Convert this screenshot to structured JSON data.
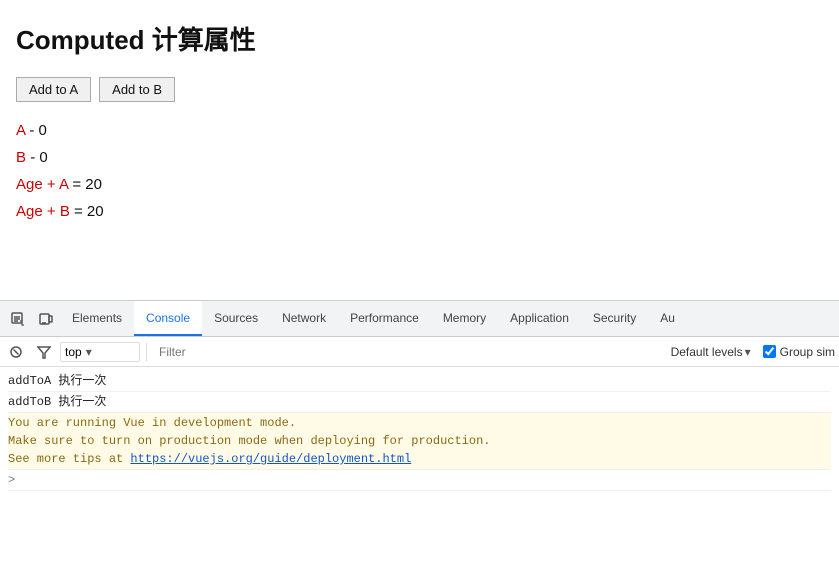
{
  "page": {
    "title": "Computed 计算属性"
  },
  "buttons": {
    "add_a": "Add to A",
    "add_b": "Add to B"
  },
  "data_lines": [
    {
      "label": "A",
      "value": "0"
    },
    {
      "label": "B",
      "value": "0"
    }
  ],
  "computed_lines": [
    {
      "text": "Age + A = 20"
    },
    {
      "text": "Age + B = 20"
    }
  ],
  "devtools": {
    "tabs": [
      "Elements",
      "Console",
      "Sources",
      "Network",
      "Performance",
      "Memory",
      "Application",
      "Security",
      "Au..."
    ],
    "active_tab": "Console",
    "context": "top",
    "filter_placeholder": "Filter",
    "default_levels": "Default levels",
    "group_sim": "Group sim"
  },
  "console": {
    "lines": [
      {
        "type": "info",
        "text": "addToA 执行一次"
      },
      {
        "type": "info",
        "text": "addToB 执行一次"
      },
      {
        "type": "warn",
        "text": "You are running Vue in development mode.\nMake sure to turn on production mode when deploying for production.\nSee more tips at "
      },
      {
        "type": "link",
        "text": "https://vuejs.org/guide/deployment.html"
      },
      {
        "type": "prompt",
        "text": ">"
      }
    ]
  }
}
